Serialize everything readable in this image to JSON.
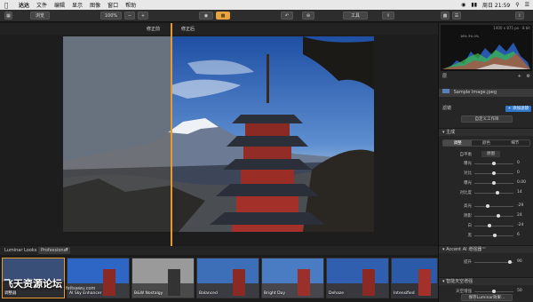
{
  "menubar": {
    "app_name": "达达",
    "items": [
      "文件",
      "编辑",
      "显示",
      "图像",
      "窗口",
      "帮助"
    ],
    "time": "周日 21:59"
  },
  "toolbar": {
    "view_label": "浏览",
    "zoom_label": "100%",
    "zoom_out": "−",
    "zoom_in": "+",
    "tools_label": "工具"
  },
  "compare": {
    "before_label": "修正前",
    "after_label": "修正后"
  },
  "histogram": {
    "info": "1400 x 875 px · 8 bit",
    "stats": "16% 3% 0%"
  },
  "panel": {
    "layers_label": "层",
    "file_name": "Sample Image.jpeg",
    "filters_label": "滤镜",
    "add_filter_label": "+ 添加滤镜",
    "workspace_label": "自定义工作目",
    "section_essentials": "主成",
    "tabs": [
      "调整",
      "颜色",
      "细节"
    ],
    "vibrance_label": "自平衡",
    "vibrance_value": "原图",
    "sliders": [
      {
        "label": "曝光",
        "value": "0",
        "pos": 0.5
      },
      {
        "label": "对比",
        "value": "0",
        "pos": 0.5
      },
      {
        "label": "曝光",
        "value": "0.00",
        "pos": 0.5
      },
      {
        "label": "对比度",
        "value": "14",
        "pos": 0.6
      },
      {
        "label": "高光",
        "value": "-29",
        "pos": 0.35
      },
      {
        "label": "阴影",
        "value": "24",
        "pos": 0.62
      },
      {
        "label": "白",
        "value": "-24",
        "pos": 0.38
      },
      {
        "label": "黑",
        "value": "6",
        "pos": 0.53
      }
    ],
    "section_ai": "Accent AI 增强器™",
    "ai_slider": {
      "label": "提升",
      "value": "90",
      "pos": 0.9
    },
    "section_sky": "智能天空增强",
    "sky_slider": {
      "label": "天空增强",
      "value": "50",
      "pos": 0.5
    },
    "reset_label": "保存Luminar效果..."
  },
  "looks": {
    "label": "Luminar Looks",
    "category": "Professional",
    "thumbs": [
      {
        "name": "调整器",
        "selected": true
      },
      {
        "name": "AI Sky Enhancer",
        "selected": false
      },
      {
        "name": "B&W Nostalgy",
        "selected": false
      },
      {
        "name": "Balanced",
        "selected": false
      },
      {
        "name": "Bright Day",
        "selected": false
      },
      {
        "name": "Dehaze",
        "selected": false
      },
      {
        "name": "Intensified",
        "selected": false
      }
    ]
  },
  "watermark": {
    "text": "飞天资源论坛",
    "url": "feitsawu.com"
  },
  "colors": {
    "accent": "#e89a2c",
    "panel_bg": "#262626",
    "blue": "#2f76c9"
  }
}
